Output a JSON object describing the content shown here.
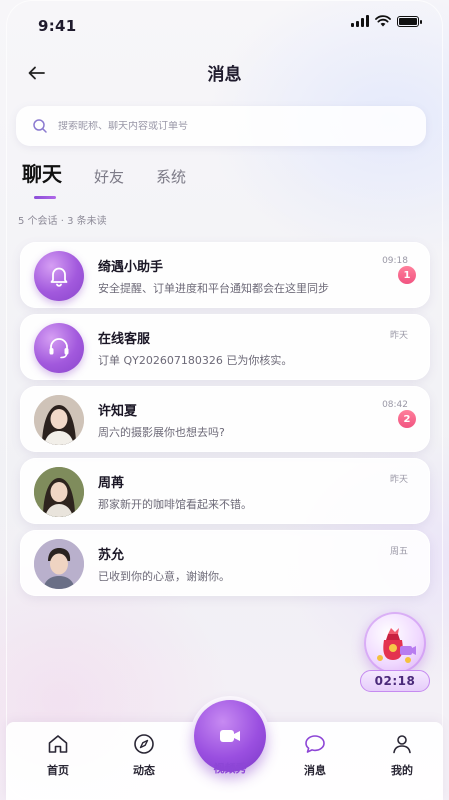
{
  "status_bar": {
    "time": "9:41"
  },
  "header": {
    "title": "消息"
  },
  "search": {
    "placeholder": "搜索昵称、聊天内容或订单号"
  },
  "tabs": [
    {
      "label": "聊天",
      "active": true
    },
    {
      "label": "好友",
      "active": false
    },
    {
      "label": "系统",
      "active": false
    }
  ],
  "summary": "5 个会话 · 3 条未读",
  "conversations": [
    {
      "name": "绮遇小助手",
      "preview": "安全提醒、订单进度和平台通知都会在这里同步",
      "time": "09:18",
      "unread": "1",
      "avatar": "bell-icon"
    },
    {
      "name": "在线客服",
      "preview": "订单 QY202607180326 已为你核实。",
      "time": "昨天",
      "unread": "",
      "avatar": "headset-icon"
    },
    {
      "name": "许知夏",
      "preview": "周六的摄影展你也想去吗?",
      "time": "08:42",
      "unread": "2",
      "avatar": "user-photo"
    },
    {
      "name": "周苒",
      "preview": "那家新开的咖啡馆看起来不错。",
      "time": "昨天",
      "unread": "",
      "avatar": "user-photo"
    },
    {
      "name": "苏允",
      "preview": "已收到你的心意，谢谢你。",
      "time": "周五",
      "unread": "",
      "avatar": "user-photo"
    }
  ],
  "float_widget": {
    "timer": "02:18",
    "icon": "gift-bag-icon"
  },
  "bottom_nav": {
    "home": "首页",
    "moments": "动态",
    "video": "视频秀",
    "messages": "消息",
    "profile": "我的"
  },
  "colors": {
    "accent": "#9a4fe0",
    "badge": "#f15481",
    "active_nav": "#8d46d6"
  }
}
